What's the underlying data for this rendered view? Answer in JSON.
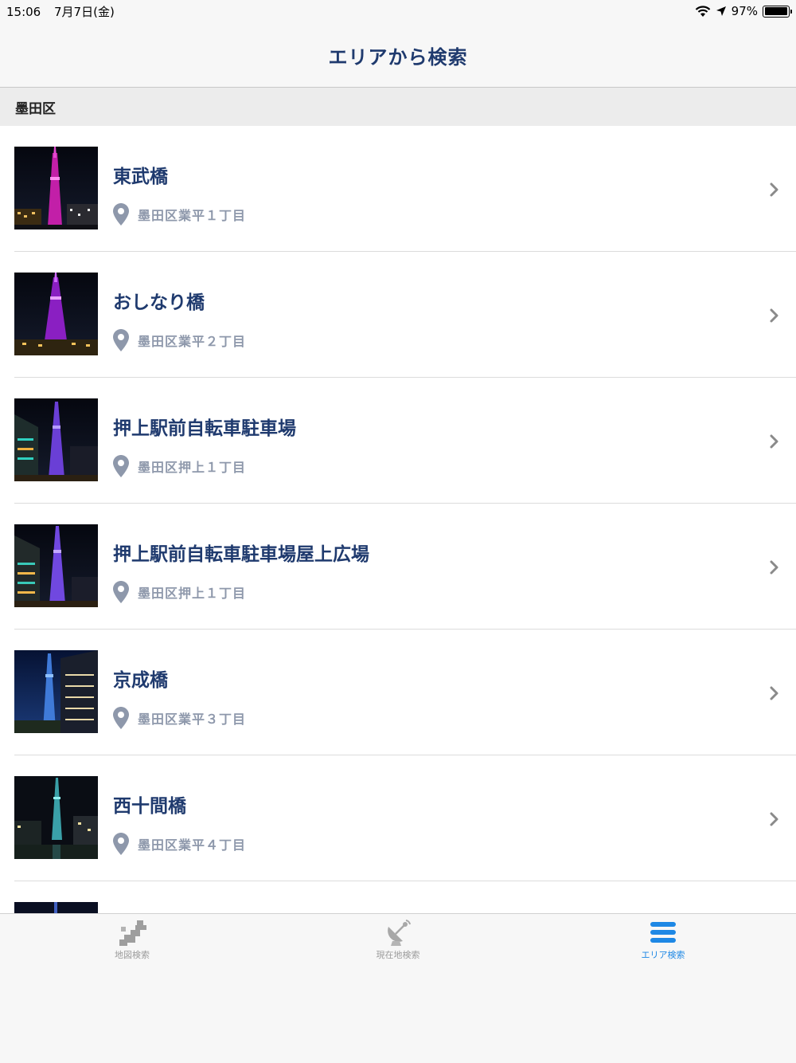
{
  "status_bar": {
    "time": "15:06",
    "date": "7月7日(金)",
    "battery_percent": "97%",
    "battery_level": 0.97
  },
  "nav": {
    "title": "エリアから検索"
  },
  "section": {
    "title": "墨田区"
  },
  "items": [
    {
      "name": "東武橋",
      "address": "墨田区業平１丁目",
      "photo": "skytree-magenta"
    },
    {
      "name": "おしなり橋",
      "address": "墨田区業平２丁目",
      "photo": "skytree-purple"
    },
    {
      "name": "押上駅前自転車駐車場",
      "address": "墨田区押上１丁目",
      "photo": "skytree-violet-building"
    },
    {
      "name": "押上駅前自転車駐車場屋上広場",
      "address": "墨田区押上１丁目",
      "photo": "skytree-violet-building"
    },
    {
      "name": "京成橋",
      "address": "墨田区業平３丁目",
      "photo": "skytree-blue-building"
    },
    {
      "name": "西十間橋",
      "address": "墨田区業平４丁目",
      "photo": "skytree-river-night"
    }
  ],
  "tabs": [
    {
      "label": "地図検索",
      "icon": "japan-map-icon",
      "active": false
    },
    {
      "label": "現在地検索",
      "icon": "satellite-dish-icon",
      "active": false
    },
    {
      "label": "エリア検索",
      "icon": "list-icon",
      "active": true
    }
  ],
  "colors": {
    "title": "#1f3a6e",
    "address": "#8e98ab",
    "active_tab": "#1e88e5",
    "inactive_tab": "#9b9b9b"
  }
}
